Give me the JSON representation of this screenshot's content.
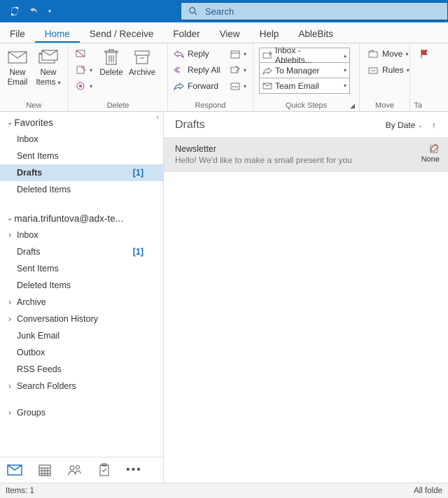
{
  "titlebar": {
    "search_placeholder": "Search"
  },
  "menu": {
    "tabs": [
      "File",
      "Home",
      "Send / Receive",
      "Folder",
      "View",
      "Help",
      "AbleBits"
    ],
    "active": 1
  },
  "ribbon": {
    "new_group": {
      "label": "New",
      "new_email": "New\nEmail",
      "new_items": "New\nItems"
    },
    "delete_group": {
      "label": "Delete",
      "delete": "Delete",
      "archive": "Archive"
    },
    "respond_group": {
      "label": "Respond",
      "reply": "Reply",
      "reply_all": "Reply All",
      "forward": "Forward"
    },
    "quicksteps_group": {
      "label": "Quick Steps",
      "items": [
        "Inbox - Ablebits...",
        "To Manager",
        "Team Email"
      ]
    },
    "move_group": {
      "label": "Move",
      "move": "Move",
      "rules": "Rules"
    },
    "tags_group": {
      "label": "Ta"
    }
  },
  "nav": {
    "favorites": {
      "title": "Favorites",
      "items": [
        {
          "label": "Inbox"
        },
        {
          "label": "Sent Items"
        },
        {
          "label": "Drafts",
          "count": "[1]",
          "selected": true
        },
        {
          "label": "Deleted Items"
        }
      ]
    },
    "account": {
      "title": "maria.trifuntova@adx-te...",
      "items": [
        {
          "label": "Inbox",
          "expandable": true
        },
        {
          "label": "Drafts",
          "count": "[1]"
        },
        {
          "label": "Sent Items"
        },
        {
          "label": "Deleted Items"
        },
        {
          "label": "Archive",
          "expandable": true
        },
        {
          "label": "Conversation History",
          "expandable": true
        },
        {
          "label": "Junk Email"
        },
        {
          "label": "Outbox"
        },
        {
          "label": "RSS Feeds"
        },
        {
          "label": "Search Folders",
          "expandable": true
        }
      ]
    },
    "groups": {
      "title": "Groups"
    }
  },
  "content": {
    "title": "Drafts",
    "sort": "By Date",
    "messages": [
      {
        "subject": "Newsletter",
        "preview": "Hello!  We'd like to make a small present for you",
        "flag": "None"
      }
    ]
  },
  "statusbar": {
    "left": "Items: 1",
    "right": "All folde"
  }
}
